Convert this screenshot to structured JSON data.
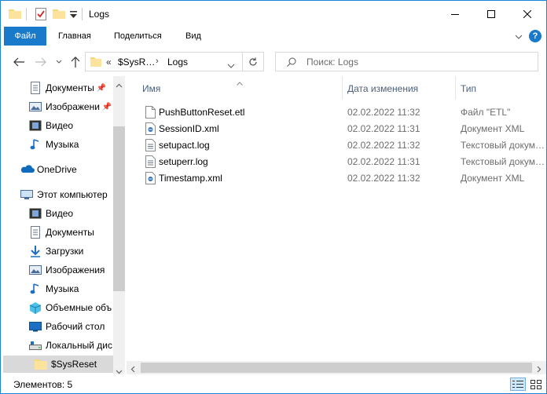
{
  "window": {
    "title": "Logs"
  },
  "ribbon": {
    "file": "Файл",
    "home": "Главная",
    "share": "Поделиться",
    "view": "Вид"
  },
  "address": {
    "prefix": "«",
    "crumb1": "$SysR…",
    "crumb2": "Logs"
  },
  "search": {
    "placeholder": "Поиск: Logs"
  },
  "nav": {
    "quick_items": [
      {
        "label": "Документы",
        "icon": "documents-icon",
        "pinned": true
      },
      {
        "label": "Изображени",
        "icon": "pictures-icon",
        "pinned": true
      },
      {
        "label": "Видео",
        "icon": "video-icon"
      },
      {
        "label": "Музыка",
        "icon": "music-icon"
      }
    ],
    "onedrive": "OneDrive",
    "this_pc": "Этот компьютер",
    "pc_items": [
      {
        "label": "Видео",
        "icon": "video-icon"
      },
      {
        "label": "Документы",
        "icon": "documents-icon"
      },
      {
        "label": "Загрузки",
        "icon": "downloads-icon"
      },
      {
        "label": "Изображения",
        "icon": "pictures-icon"
      },
      {
        "label": "Музыка",
        "icon": "music-icon"
      },
      {
        "label": "Объемные объ",
        "icon": "3d-objects-icon"
      },
      {
        "label": "Рабочий стол",
        "icon": "desktop-icon"
      },
      {
        "label": "Локальный дис",
        "icon": "drive-icon"
      }
    ],
    "selected": "$SysReset"
  },
  "columns": {
    "name": "Имя",
    "date": "Дата изменения",
    "type": "Тип"
  },
  "files": [
    {
      "name": "PushButtonReset.etl",
      "date": "02.02.2022 11:32",
      "type": "Файл \"ETL\"",
      "icon": "file-icon"
    },
    {
      "name": "SessionID.xml",
      "date": "02.02.2022 11:31",
      "type": "Документ XML",
      "icon": "xml-file-icon"
    },
    {
      "name": "setupact.log",
      "date": "02.02.2022 11:32",
      "type": "Текстовый докум…",
      "icon": "text-file-icon"
    },
    {
      "name": "setuperr.log",
      "date": "02.02.2022 11:31",
      "type": "Текстовый докум…",
      "icon": "text-file-icon"
    },
    {
      "name": "Timestamp.xml",
      "date": "02.02.2022 11:32",
      "type": "Документ XML",
      "icon": "xml-file-icon"
    }
  ],
  "status": {
    "text": "Элементов: 5"
  },
  "colors": {
    "accent": "#1979ca",
    "folder": "#f8d775",
    "border": "#1883d7"
  }
}
